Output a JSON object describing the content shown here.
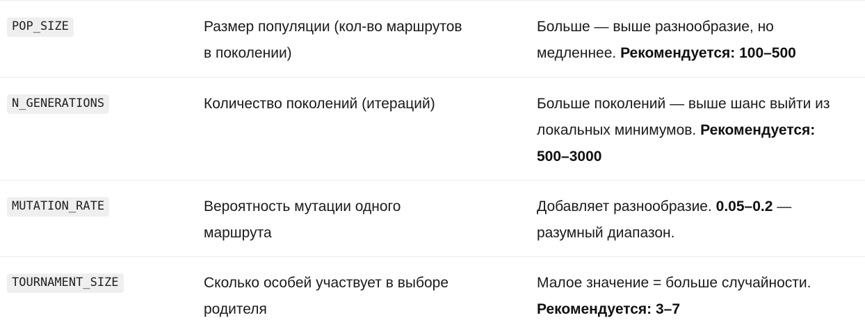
{
  "rows": [
    {
      "param": "POP_SIZE",
      "desc_lines": [
        "Размер популяции (кол-во маршрутов",
        "в поколении)"
      ],
      "note_l1": "Больше — выше разнообразие, но",
      "note_l2_pre": "медленнее. ",
      "note_l2_bold": "Рекомендуется: 100–500"
    },
    {
      "param": "N_GENERATIONS",
      "desc_lines": [
        "Количество поколений (итераций)"
      ],
      "note_l1": "Больше поколений — выше шанс выйти из",
      "note_l2_pre": "локальных минимумов. ",
      "note_l2_bold": "Рекомендуется:",
      "note_l3_bold": "500–3000"
    },
    {
      "param": "MUTATION_RATE",
      "desc_lines": [
        "Вероятность мутации одного",
        "маршрута"
      ],
      "note_l1_pre": "Добавляет разнообразие. ",
      "note_l1_bold": "0.05–0.2",
      "note_l1_post": " —",
      "note_l2": "разумный диапазон."
    },
    {
      "param": "TOURNAMENT_SIZE",
      "desc_lines": [
        "Сколько особей участвует в выборе",
        "родителя"
      ],
      "note_l1": "Малое значение = больше случайности.",
      "note_l2_bold": "Рекомендуется: 3–7"
    }
  ]
}
